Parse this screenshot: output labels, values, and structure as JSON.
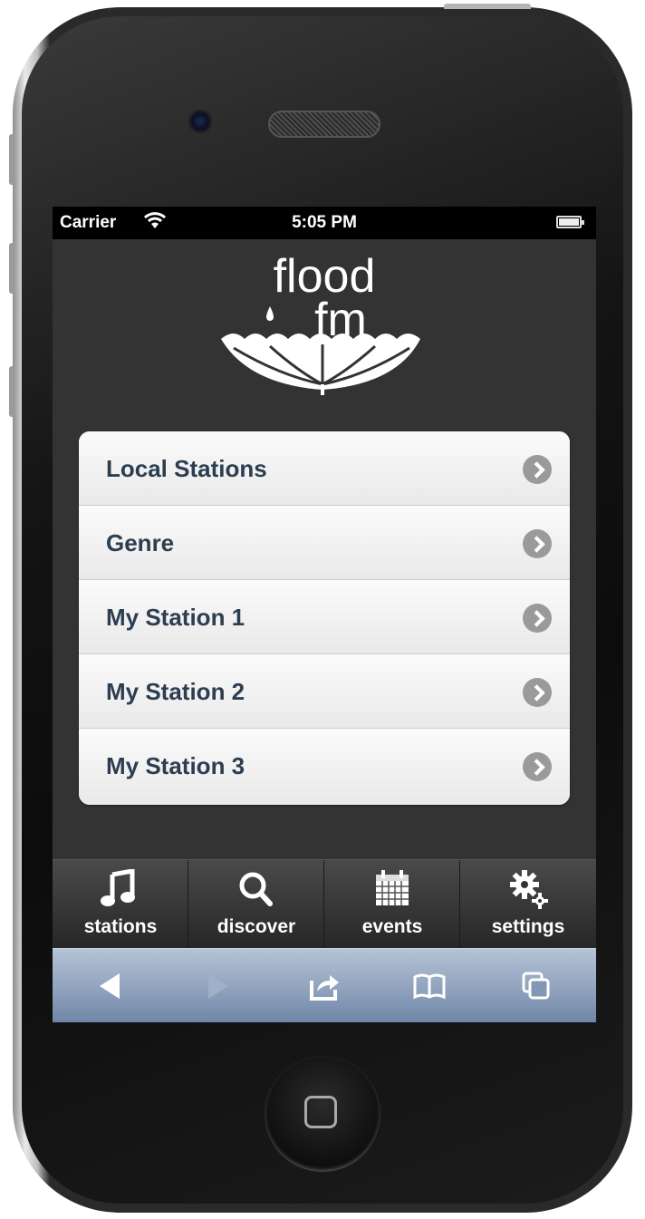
{
  "status_bar": {
    "carrier": "Carrier",
    "time": "5:05 PM"
  },
  "logo": {
    "line1": "flood",
    "line2": "fm"
  },
  "menu": {
    "items": [
      {
        "label": "Local Stations"
      },
      {
        "label": "Genre"
      },
      {
        "label": "My Station 1"
      },
      {
        "label": "My Station 2"
      },
      {
        "label": "My Station 3"
      }
    ]
  },
  "tabs": [
    {
      "label": "stations",
      "icon": "music-note-icon"
    },
    {
      "label": "discover",
      "icon": "search-icon"
    },
    {
      "label": "events",
      "icon": "calendar-icon"
    },
    {
      "label": "settings",
      "icon": "gears-icon"
    }
  ],
  "browser_toolbar": {
    "buttons": [
      "back-icon",
      "forward-icon",
      "share-icon",
      "bookmarks-icon",
      "pages-icon"
    ]
  },
  "colors": {
    "menu_text": "#2c3e50",
    "screen_bg": "#333333",
    "toolbar_blue": "#8ea0bb"
  }
}
